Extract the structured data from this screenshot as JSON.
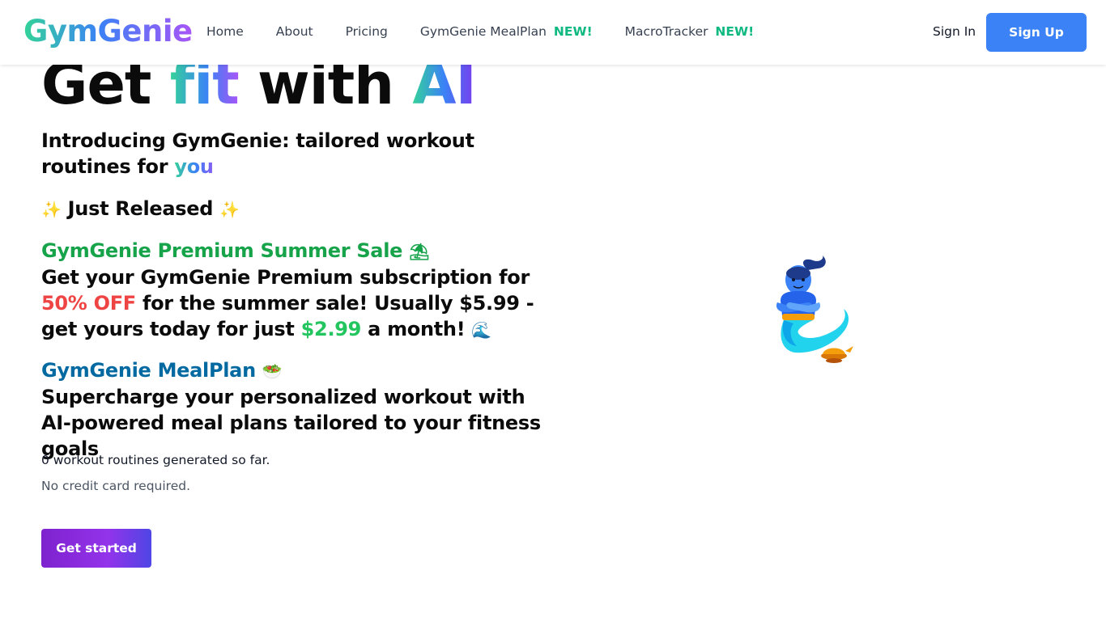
{
  "nav": {
    "logo": "GymGenie",
    "links": [
      {
        "label": "Home"
      },
      {
        "label": "About"
      },
      {
        "label": "Pricing"
      },
      {
        "label": "GymGenie MealPlan",
        "badge": "NEW!"
      },
      {
        "label": "MacroTracker",
        "badge": "NEW!"
      }
    ],
    "signin": "Sign In",
    "signup": "Sign Up"
  },
  "hero": {
    "title_get": "Get ",
    "title_fit": "fit",
    "title_with": " with ",
    "title_ai": "AI",
    "intro": "Introducing GymGenie: tailored workout routines for ",
    "intro_you": "you",
    "released_emoji_left": "✨",
    "released": " Just Released ",
    "released_emoji_right": "✨",
    "sale_title": "GymGenie Premium Summer Sale ",
    "sale_title_emoji": "⛱",
    "sale_text_1": "Get your GymGenie Premium subscription for ",
    "sale_discount": "50% OFF",
    "sale_text_2": " for the summer sale! Usually $5.99 - get yours today for just ",
    "sale_price": "$2.99",
    "sale_text_3": " a month! ",
    "sale_text_emoji": "🌊",
    "meal_title": "GymGenie MealPlan ",
    "meal_title_emoji": "🥗",
    "meal_text": "Supercharge your personalized workout with AI-powered meal plans tailored to your fitness goals",
    "count_text": "0 workout routines generated so far.",
    "no_card": "No credit card required.",
    "cta": "Get started"
  },
  "colors": {
    "signup_bg": "#3b82f6",
    "sale_green": "#16a34a",
    "meal_blue": "#0369a1",
    "discount_red": "#ef4444",
    "price_green": "#22c55e",
    "new_badge": "#10b981",
    "cta_purple": "#7e22ce"
  },
  "icons": {
    "genie": "genie-illustration"
  }
}
